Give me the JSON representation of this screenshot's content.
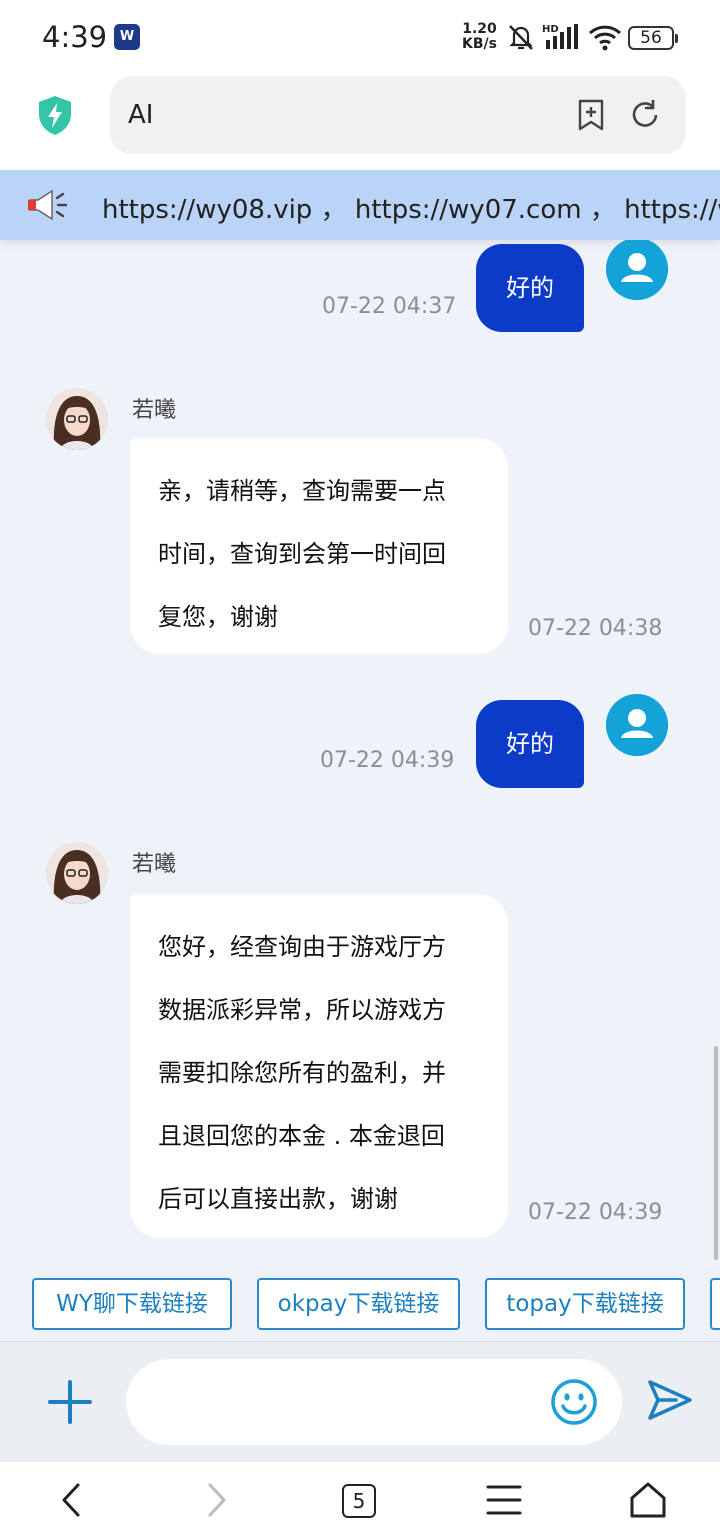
{
  "status_bar": {
    "time": "4:39",
    "app_badge": "W",
    "net_speed_value": "1.20",
    "net_speed_unit": "KB/s",
    "battery": "56"
  },
  "browser": {
    "address": "AI"
  },
  "marquee": {
    "text": "https://wy08.vip ， https://wy07.com ， https://wy0"
  },
  "chat": {
    "messages": [
      {
        "type": "outgoing",
        "text": "好的",
        "time": "07-22 04:37"
      },
      {
        "type": "incoming",
        "sender": "若曦",
        "lines": [
          "亲，请稍等，查询需要一点",
          "时间，查询到会第一时间回",
          "复您，谢谢"
        ],
        "time": "07-22 04:38"
      },
      {
        "type": "outgoing",
        "text": "好的",
        "time": "07-22 04:39"
      },
      {
        "type": "incoming",
        "sender": "若曦",
        "lines": [
          "您好，经查询由于游戏厅方",
          "数据派彩异常，所以游戏方",
          "需要扣除您所有的盈利，并",
          "且退回您的本金 . 本金退回",
          "后可以直接出款，谢谢"
        ],
        "time": "07-22 04:39"
      }
    ]
  },
  "quick_links": [
    "WY聊下载链接",
    "okpay下载链接",
    "topay下载链接"
  ],
  "input": {
    "placeholder": ""
  },
  "nav": {
    "tab_count": "5"
  },
  "colors": {
    "outgoing_bubble": "#0c3bc8",
    "user_avatar": "#14a3d8",
    "quick_link_border": "#2a89c4",
    "marquee_bg": "#b9d4f7",
    "chat_bg": "#eef3f9"
  },
  "icons": [
    "app-badge-icon",
    "mute-bell-icon",
    "signal-icon",
    "wifi-icon",
    "battery-icon",
    "shield-bolt-icon",
    "add-bookmark-icon",
    "reload-icon",
    "megaphone-icon",
    "user-avatar-icon",
    "plus-icon",
    "emoji-icon",
    "send-icon",
    "back-icon",
    "forward-icon",
    "menu-icon",
    "home-icon"
  ]
}
